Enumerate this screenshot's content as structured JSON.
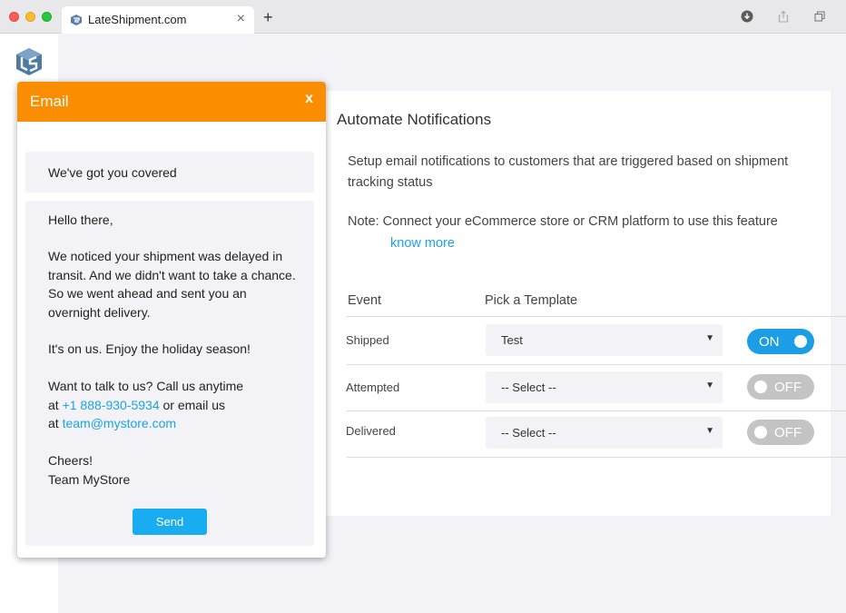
{
  "browser": {
    "tab_title": "LateShipment.com",
    "close_glyph": "×",
    "new_tab_glyph": "+"
  },
  "page": {
    "title": "Automate Notifications",
    "description": "Setup email notifications to customers that are triggered based on shipment tracking status",
    "note": "Note: Connect your eCommerce store or CRM platform to use this feature",
    "know_more": "know more",
    "columns": {
      "event": "Event",
      "template": "Pick a Template"
    },
    "rows": [
      {
        "event": "Shipped",
        "template": "Test",
        "toggle": "ON"
      },
      {
        "event": "Attempted",
        "template": "-- Select --",
        "toggle": "OFF"
      },
      {
        "event": "Delivered",
        "template": "-- Select --",
        "toggle": "OFF"
      }
    ],
    "select_arrow": "▼"
  },
  "email": {
    "title": "Email",
    "close": "x",
    "subject": "We've got you covered",
    "greeting": "Hello there,",
    "para1_line1": "We noticed your shipment was delayed in",
    "para1_line2": "transit. And we didn't want to take a chance.",
    "para1_line3": "So we went ahead and sent you an",
    "para1_line4": "overnight delivery.",
    "para2": "It's on us. Enjoy the holiday season!",
    "para3_line1": "Want to talk to us? Call us anytime",
    "para3_at1": "at ",
    "phone": "+1 888-930-5934",
    "para3_or": " or email us",
    "para3_at2": "at ",
    "email_address": "team@mystore.com",
    "signoff1": "Cheers!",
    "signoff2": "Team MyStore",
    "send": "Send"
  },
  "colors": {
    "accent": "#fb8e00",
    "link": "#1aa3e8",
    "toggle_on": "#1b9ee6",
    "toggle_off": "#c4c4c4"
  },
  "icons": [
    "favicon-icon",
    "download-icon",
    "share-icon",
    "window-icon",
    "logo-icon",
    "close-icon",
    "chevron-down-icon"
  ]
}
